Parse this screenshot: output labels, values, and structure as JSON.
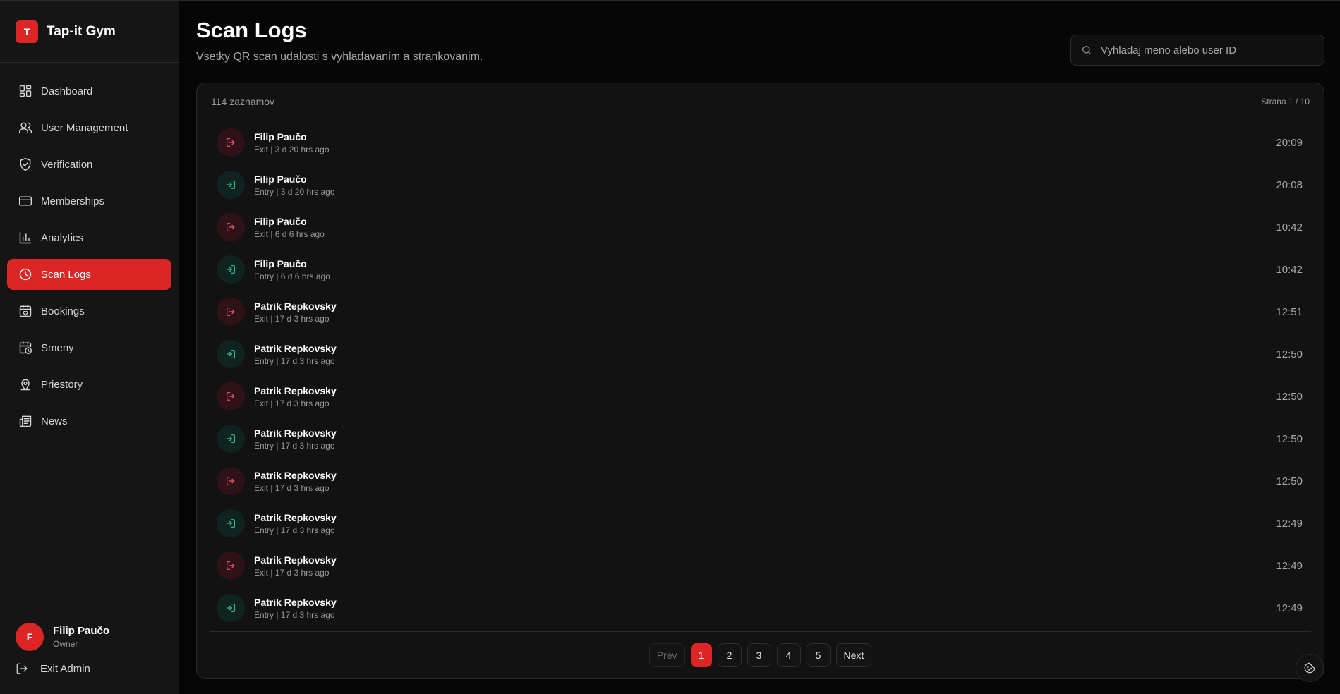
{
  "brand": {
    "logo_letter": "T",
    "name": "Tap-it Gym"
  },
  "nav": {
    "items": [
      {
        "label": "Dashboard",
        "icon": "dashboard-icon"
      },
      {
        "label": "User Management",
        "icon": "users-icon"
      },
      {
        "label": "Verification",
        "icon": "shield-check-icon"
      },
      {
        "label": "Memberships",
        "icon": "credit-card-icon"
      },
      {
        "label": "Analytics",
        "icon": "bar-chart-icon"
      },
      {
        "label": "Scan Logs",
        "icon": "clock-icon",
        "active": true
      },
      {
        "label": "Bookings",
        "icon": "calendar-heart-icon"
      },
      {
        "label": "Smeny",
        "icon": "calendar-clock-icon"
      },
      {
        "label": "Priestory",
        "icon": "map-pin-icon"
      },
      {
        "label": "News",
        "icon": "newspaper-icon"
      }
    ]
  },
  "user": {
    "initial": "F",
    "name": "Filip Paučo",
    "role": "Owner"
  },
  "exit_label": "Exit Admin",
  "page": {
    "title": "Scan Logs",
    "subtitle": "Vsetky QR scan udalosti s vyhladavanim a strankovanim."
  },
  "search": {
    "placeholder": "Vyhladaj meno alebo user ID",
    "value": ""
  },
  "card": {
    "count": "114 zaznamov",
    "page_info": "Strana 1 / 10"
  },
  "logs": [
    {
      "name": "Filip Paučo",
      "detail": "Exit | 3 d 20 hrs ago",
      "time": "20:09",
      "type": "exit"
    },
    {
      "name": "Filip Paučo",
      "detail": "Entry | 3 d 20 hrs ago",
      "time": "20:08",
      "type": "entry"
    },
    {
      "name": "Filip Paučo",
      "detail": "Exit | 6 d 6 hrs ago",
      "time": "10:42",
      "type": "exit"
    },
    {
      "name": "Filip Paučo",
      "detail": "Entry | 6 d 6 hrs ago",
      "time": "10:42",
      "type": "entry"
    },
    {
      "name": "Patrik Repkovsky",
      "detail": "Exit | 17 d 3 hrs ago",
      "time": "12:51",
      "type": "exit"
    },
    {
      "name": "Patrik Repkovsky",
      "detail": "Entry | 17 d 3 hrs ago",
      "time": "12:50",
      "type": "entry"
    },
    {
      "name": "Patrik Repkovsky",
      "detail": "Exit | 17 d 3 hrs ago",
      "time": "12:50",
      "type": "exit"
    },
    {
      "name": "Patrik Repkovsky",
      "detail": "Entry | 17 d 3 hrs ago",
      "time": "12:50",
      "type": "entry"
    },
    {
      "name": "Patrik Repkovsky",
      "detail": "Exit | 17 d 3 hrs ago",
      "time": "12:50",
      "type": "exit"
    },
    {
      "name": "Patrik Repkovsky",
      "detail": "Entry | 17 d 3 hrs ago",
      "time": "12:49",
      "type": "entry"
    },
    {
      "name": "Patrik Repkovsky",
      "detail": "Exit | 17 d 3 hrs ago",
      "time": "12:49",
      "type": "exit"
    },
    {
      "name": "Patrik Repkovsky",
      "detail": "Entry | 17 d 3 hrs ago",
      "time": "12:49",
      "type": "entry"
    }
  ],
  "pagination": {
    "prev": "Prev",
    "next": "Next",
    "pages": [
      "1",
      "2",
      "3",
      "4",
      "5"
    ],
    "current": "1"
  },
  "colors": {
    "accent": "#dc2626",
    "exit": "#f0576b",
    "entry": "#34c794"
  }
}
